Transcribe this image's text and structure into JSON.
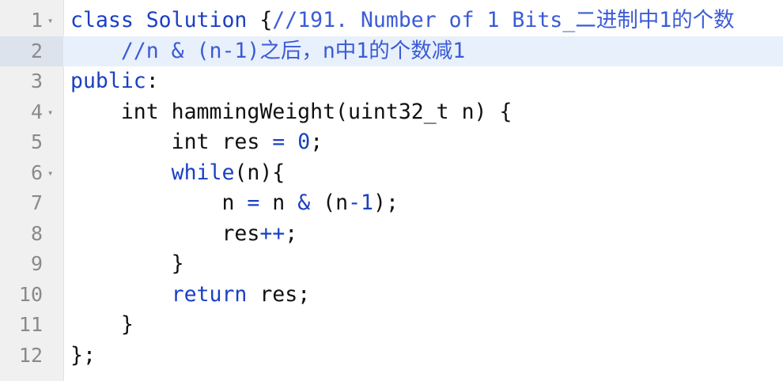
{
  "editor": {
    "fold_glyph": "▾",
    "lines": [
      {
        "n": "1",
        "fold": true,
        "tokens": [
          {
            "t": "class Solution",
            "c": "kw"
          },
          {
            "t": " {",
            "c": "pl"
          },
          {
            "t": "//191. Number of 1 Bits_二进制中1的个数",
            "c": "cm"
          }
        ]
      },
      {
        "n": "2",
        "active": true,
        "tokens": [
          {
            "t": "    ",
            "c": "pl"
          },
          {
            "t": "//n & (n-1)之后，n中1的个数减1",
            "c": "cm"
          }
        ]
      },
      {
        "n": "3",
        "tokens": [
          {
            "t": "public",
            "c": "kw"
          },
          {
            "t": ":",
            "c": "pl"
          }
        ]
      },
      {
        "n": "4",
        "fold": true,
        "tokens": [
          {
            "t": "    int hammingWeight(uint32_t n) {",
            "c": "pl"
          }
        ]
      },
      {
        "n": "5",
        "tokens": [
          {
            "t": "        int res ",
            "c": "pl"
          },
          {
            "t": "=",
            "c": "op"
          },
          {
            "t": " ",
            "c": "pl"
          },
          {
            "t": "0",
            "c": "num"
          },
          {
            "t": ";",
            "c": "pl"
          }
        ]
      },
      {
        "n": "6",
        "fold": true,
        "tokens": [
          {
            "t": "        ",
            "c": "pl"
          },
          {
            "t": "while",
            "c": "kw"
          },
          {
            "t": "(n){",
            "c": "pl"
          }
        ]
      },
      {
        "n": "7",
        "tokens": [
          {
            "t": "            n ",
            "c": "pl"
          },
          {
            "t": "=",
            "c": "op"
          },
          {
            "t": " n ",
            "c": "pl"
          },
          {
            "t": "&",
            "c": "op"
          },
          {
            "t": " (n",
            "c": "pl"
          },
          {
            "t": "-",
            "c": "op"
          },
          {
            "t": "1",
            "c": "num"
          },
          {
            "t": ");",
            "c": "pl"
          }
        ]
      },
      {
        "n": "8",
        "tokens": [
          {
            "t": "            res",
            "c": "pl"
          },
          {
            "t": "++",
            "c": "op"
          },
          {
            "t": ";",
            "c": "pl"
          }
        ]
      },
      {
        "n": "9",
        "tokens": [
          {
            "t": "        }",
            "c": "pl"
          }
        ]
      },
      {
        "n": "10",
        "tokens": [
          {
            "t": "        ",
            "c": "pl"
          },
          {
            "t": "return",
            "c": "kw"
          },
          {
            "t": " res;",
            "c": "pl"
          }
        ]
      },
      {
        "n": "11",
        "tokens": [
          {
            "t": "    }",
            "c": "pl"
          }
        ]
      },
      {
        "n": "12",
        "tokens": [
          {
            "t": "};",
            "c": "pl"
          }
        ]
      }
    ]
  }
}
